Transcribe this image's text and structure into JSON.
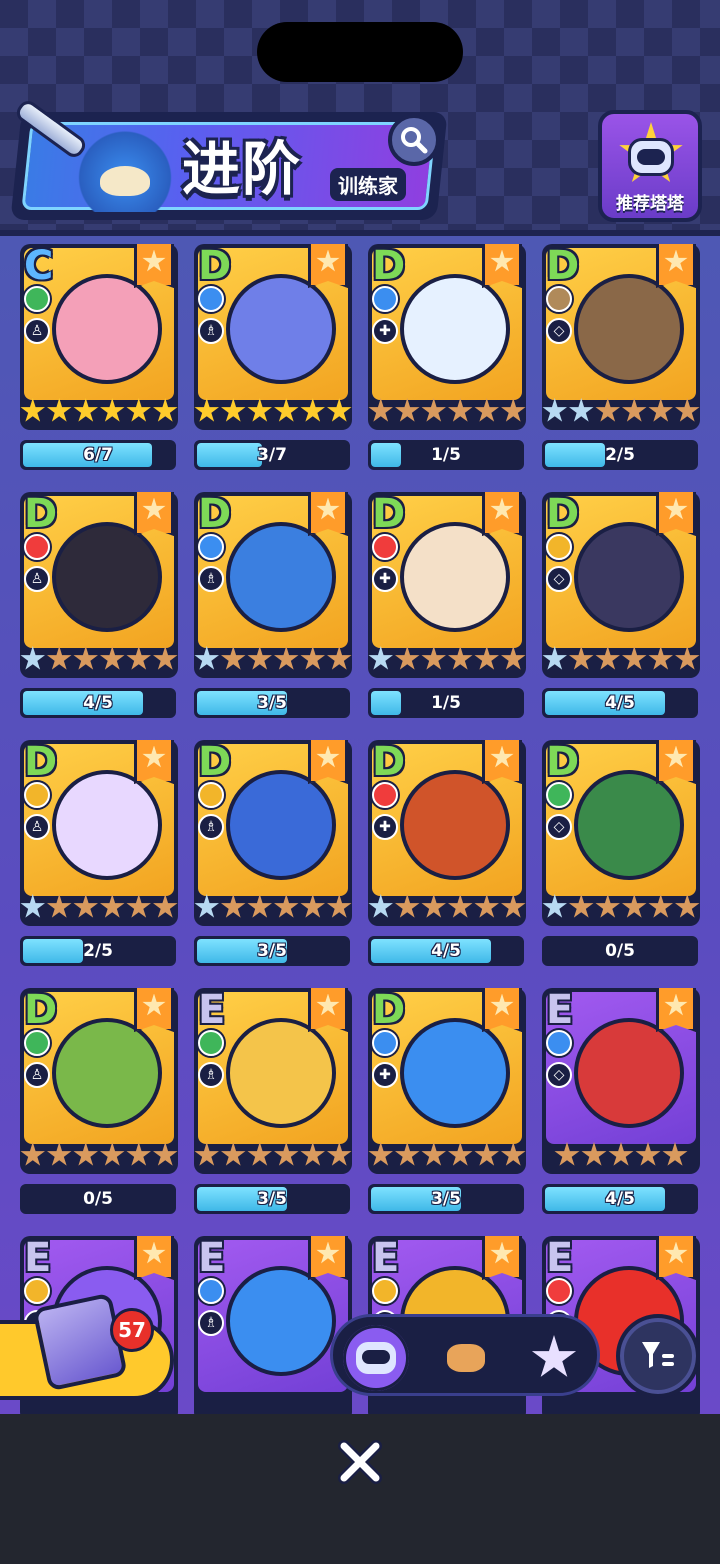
{
  "header": {
    "title": "进阶",
    "subtitle": "训练家",
    "recommend_label": "推荐塔塔"
  },
  "cards": [
    {
      "grade": "C",
      "element": "grass",
      "progress": "6/7",
      "fill": 0.857,
      "stars": [
        "gold",
        "gold",
        "gold",
        "gold",
        "gold",
        "gold"
      ],
      "bg": "gold",
      "creature_color": "#f4a0b8"
    },
    {
      "grade": "D",
      "element": "water",
      "progress": "3/7",
      "fill": 0.43,
      "stars": [
        "gold",
        "gold",
        "gold",
        "gold",
        "gold",
        "gold"
      ],
      "bg": "gold",
      "creature_color": "#6f7fe8"
    },
    {
      "grade": "D",
      "element": "water",
      "progress": "1/5",
      "fill": 0.2,
      "stars": [
        "bronze",
        "bronze",
        "bronze",
        "bronze",
        "bronze",
        "bronze"
      ],
      "bg": "gold",
      "creature_color": "#e6f1ff"
    },
    {
      "grade": "D",
      "element": "ground",
      "progress": "2/5",
      "fill": 0.4,
      "stars": [
        "silver",
        "silver",
        "bronze",
        "bronze",
        "bronze",
        "bronze"
      ],
      "bg": "gold",
      "creature_color": "#8a6848"
    },
    {
      "grade": "D",
      "element": "fire",
      "progress": "4/5",
      "fill": 0.8,
      "stars": [
        "silver",
        "bronze",
        "bronze",
        "bronze",
        "bronze",
        "bronze"
      ],
      "bg": "gold",
      "creature_color": "#2e2a3a"
    },
    {
      "grade": "D",
      "element": "water",
      "progress": "3/5",
      "fill": 0.6,
      "stars": [
        "silver",
        "bronze",
        "bronze",
        "bronze",
        "bronze",
        "bronze"
      ],
      "bg": "gold",
      "creature_color": "#3b7fe0"
    },
    {
      "grade": "D",
      "element": "fire",
      "progress": "1/5",
      "fill": 0.2,
      "stars": [
        "silver",
        "bronze",
        "bronze",
        "bronze",
        "bronze",
        "bronze"
      ],
      "bg": "gold",
      "creature_color": "#f4e0c8"
    },
    {
      "grade": "D",
      "element": "electric",
      "progress": "4/5",
      "fill": 0.8,
      "stars": [
        "silver",
        "bronze",
        "bronze",
        "bronze",
        "bronze",
        "bronze"
      ],
      "bg": "gold",
      "creature_color": "#3a3860"
    },
    {
      "grade": "D",
      "element": "electric",
      "progress": "2/5",
      "fill": 0.4,
      "stars": [
        "silver",
        "bronze",
        "bronze",
        "bronze",
        "bronze",
        "bronze"
      ],
      "bg": "gold",
      "creature_color": "#e8d8ff"
    },
    {
      "grade": "D",
      "element": "electric",
      "progress": "3/5",
      "fill": 0.6,
      "stars": [
        "silver",
        "bronze",
        "bronze",
        "bronze",
        "bronze",
        "bronze"
      ],
      "bg": "gold",
      "creature_color": "#3a6ad8"
    },
    {
      "grade": "D",
      "element": "fire",
      "progress": "4/5",
      "fill": 0.8,
      "stars": [
        "silver",
        "bronze",
        "bronze",
        "bronze",
        "bronze",
        "bronze"
      ],
      "bg": "gold",
      "creature_color": "#d0542a"
    },
    {
      "grade": "D",
      "element": "grass",
      "progress": "0/5",
      "fill": 0.0,
      "stars": [
        "silver",
        "bronze",
        "bronze",
        "bronze",
        "bronze",
        "bronze"
      ],
      "bg": "gold",
      "creature_color": "#3a8a4a"
    },
    {
      "grade": "D",
      "element": "grass",
      "progress": "0/5",
      "fill": 0.0,
      "stars": [
        "bronze",
        "bronze",
        "bronze",
        "bronze",
        "bronze",
        "bronze"
      ],
      "bg": "gold",
      "creature_color": "#7ab84a"
    },
    {
      "grade": "E",
      "element": "grass",
      "progress": "3/5",
      "fill": 0.6,
      "stars": [
        "bronze",
        "bronze",
        "bronze",
        "bronze",
        "bronze",
        "bronze"
      ],
      "bg": "gold",
      "creature_color": "#f4c44a"
    },
    {
      "grade": "D",
      "element": "water",
      "progress": "3/5",
      "fill": 0.6,
      "stars": [
        "bronze",
        "bronze",
        "bronze",
        "bronze",
        "bronze",
        "bronze"
      ],
      "bg": "gold",
      "creature_color": "#3b8ef0"
    },
    {
      "grade": "E",
      "element": "water",
      "progress": "4/5",
      "fill": 0.8,
      "stars": [
        "bronze",
        "bronze",
        "bronze",
        "bronze",
        "bronze"
      ],
      "bg": "purple",
      "creature_color": "#d83a3a"
    },
    {
      "grade": "E",
      "element": "electric",
      "progress": "",
      "fill": 0,
      "stars": [],
      "bg": "purple",
      "creature_color": "#8a5cf0"
    },
    {
      "grade": "E",
      "element": "water",
      "progress": "",
      "fill": 0,
      "stars": [],
      "bg": "purple",
      "creature_color": "#3b8ef0"
    },
    {
      "grade": "E",
      "element": "electric",
      "progress": "",
      "fill": 0,
      "stars": [],
      "bg": "purple",
      "creature_color": "#f2b52a"
    },
    {
      "grade": "E",
      "element": "fire",
      "progress": "",
      "fill": 0,
      "stars": [],
      "bg": "purple",
      "creature_color": "#e8302a"
    }
  ],
  "chest": {
    "count": "57"
  },
  "bottom_tabs": [
    {
      "name": "robot-tab",
      "icon": "robot-icon",
      "active": true
    },
    {
      "name": "bear-tab",
      "icon": "bear-icon",
      "active": false
    },
    {
      "name": "badge-tab",
      "icon": "badge-icon",
      "active": false
    }
  ],
  "close_icon": "close-icon"
}
